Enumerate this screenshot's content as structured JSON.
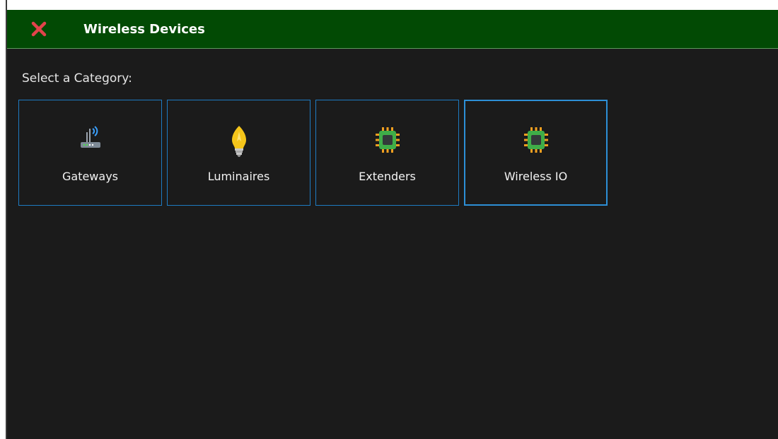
{
  "window": {
    "title": "Wireless Devices"
  },
  "colors": {
    "titlebar": "#024a04",
    "close": "#e2434b",
    "tile_border": "#1e7bc2",
    "background": "#1b1b1b"
  },
  "prompt": "Select a Category:",
  "categories": [
    {
      "label": "Gateways",
      "icon": "router-icon",
      "selected": false
    },
    {
      "label": "Luminaires",
      "icon": "light-bulb-icon",
      "selected": false
    },
    {
      "label": "Extenders",
      "icon": "chip-icon",
      "selected": false
    },
    {
      "label": "Wireless IO",
      "icon": "chip-icon",
      "selected": true
    }
  ]
}
